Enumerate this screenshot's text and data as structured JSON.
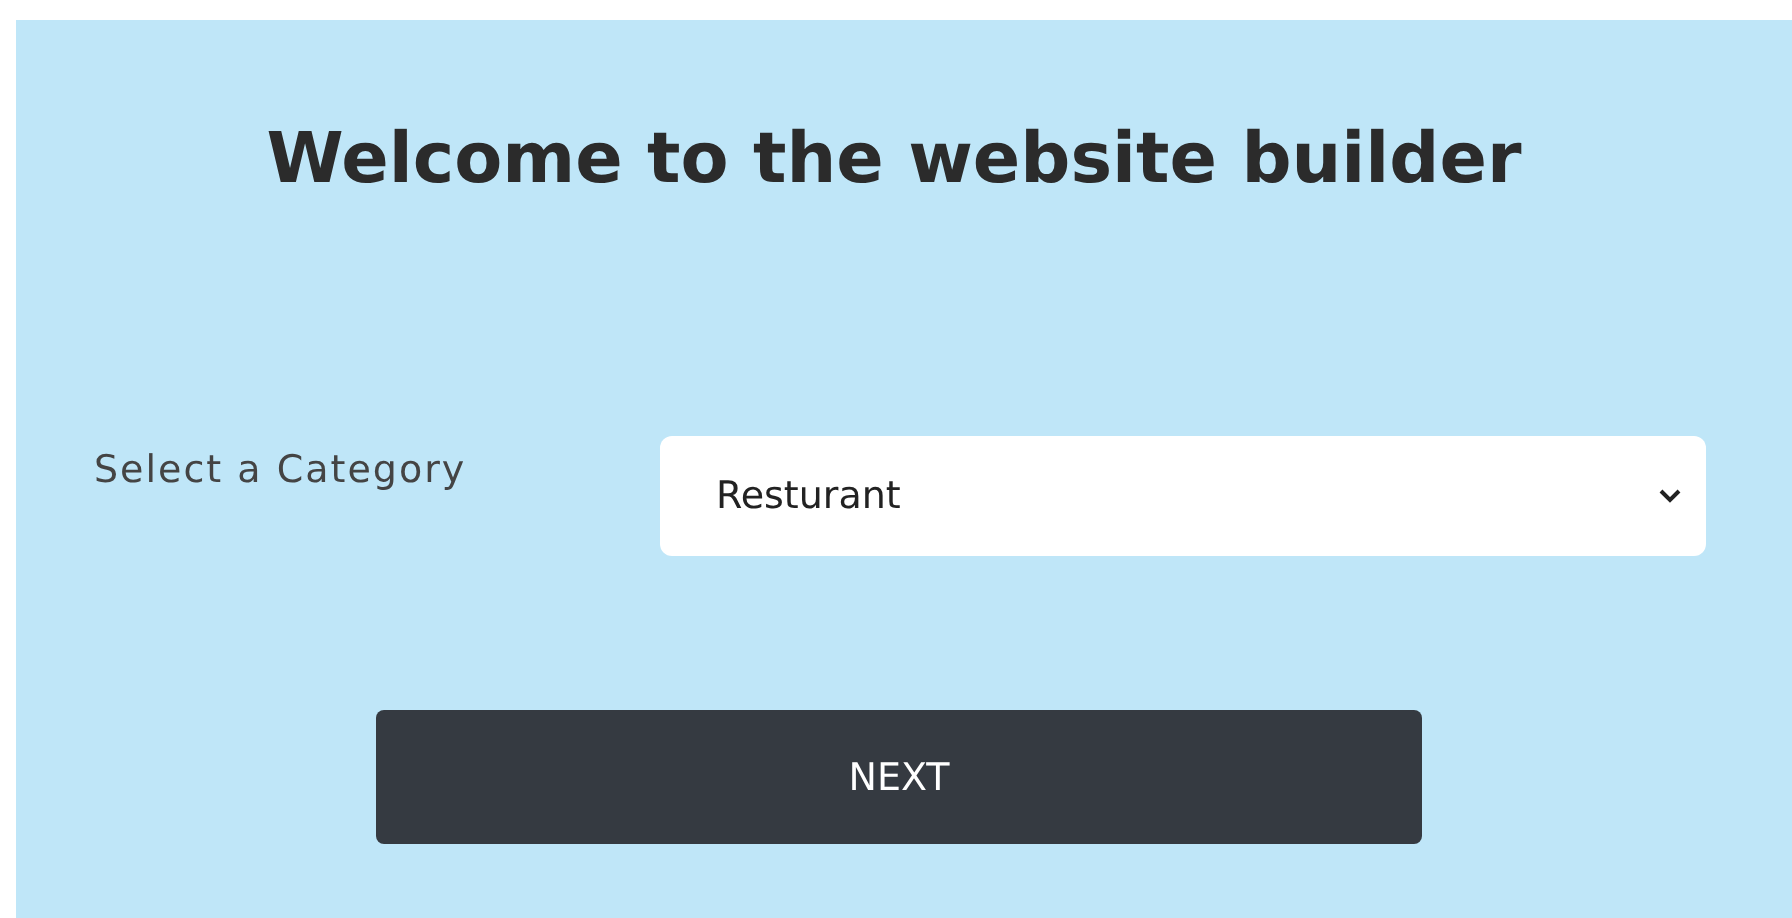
{
  "heading": "Welcome to the website builder",
  "category": {
    "label": "Select a Category",
    "value": "Resturant"
  },
  "next_button": {
    "label": "NEXT"
  }
}
